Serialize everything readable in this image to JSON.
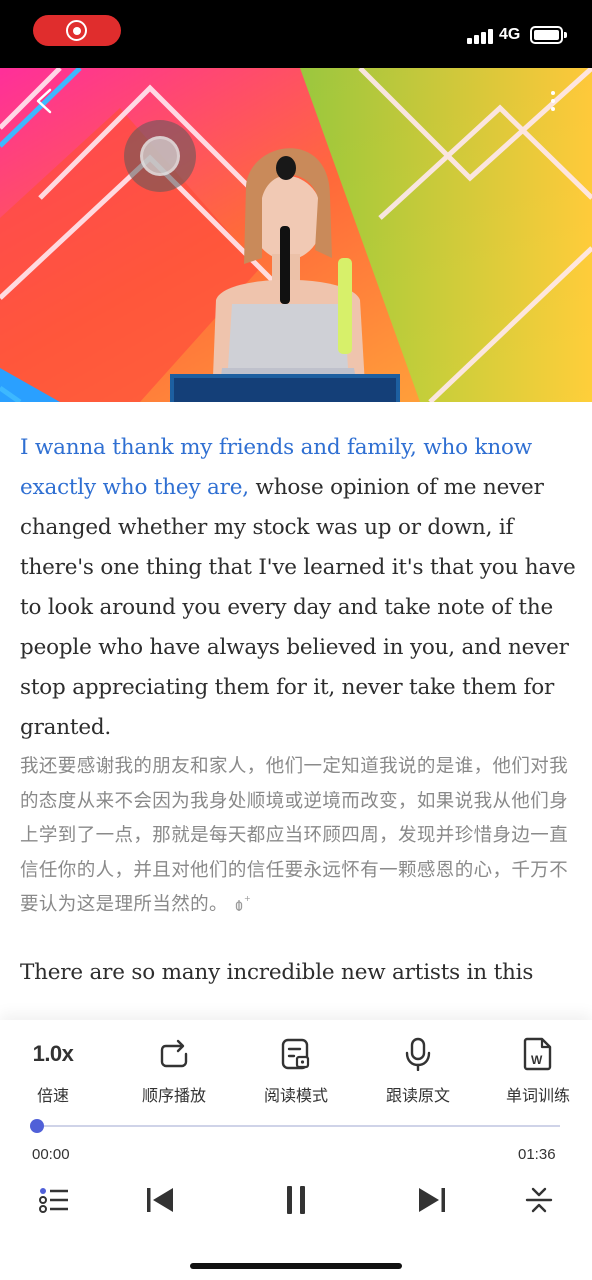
{
  "status_bar": {
    "network": "4G"
  },
  "video": {
    "icons": {
      "back": "chevron-left-icon",
      "more": "more-vertical-icon"
    }
  },
  "transcript": {
    "segments": [
      {
        "en_active": "I wanna thank my friends and family, who know exactly who they are,",
        "en_rest": " whose opinion of me never changed whether my stock was up or down, if there's one thing that I've learned it's that you have to look around you every day and take note of the people who have always believed in you, and never stop appreciating them for it, never take them for granted.",
        "zh": "我还要感谢我的朋友和家人，他们一定知道我说的是谁，他们对我的态度从来不会因为我身处顺境或逆境而改变，如果说我从他们身上学到了一点，那就是每天都应当环顾四周，发现并珍惜身边一直信任你的人，并且对他们的信任要永远怀有一颗感恩的心，千万不要认为这是理所当然的。"
      },
      {
        "en": "There are so many incredible new artists in this"
      }
    ]
  },
  "toolbar": {
    "speed_value": "1.0x",
    "speed_label": "倍速",
    "order_label": "顺序播放",
    "reading_label": "阅读模式",
    "follow_label": "跟读原文",
    "vocab_label": "单词训练"
  },
  "player": {
    "current_time": "00:00",
    "duration": "01:36",
    "progress": 0,
    "accent_color": "#5060d8",
    "highlight_color": "#2f6fd2"
  }
}
